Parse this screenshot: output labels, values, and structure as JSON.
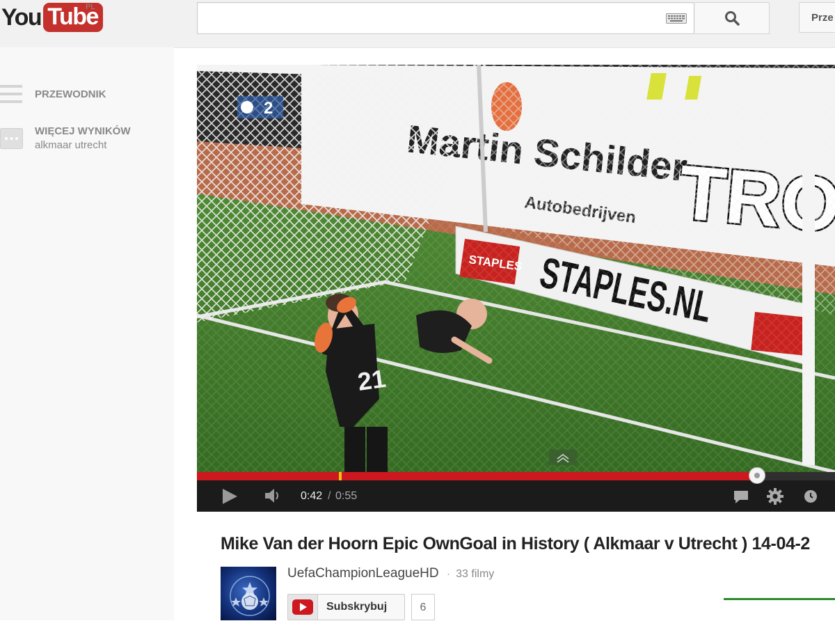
{
  "header": {
    "logo": {
      "you": "You",
      "tube": "Tube",
      "region": "PL"
    },
    "search": {
      "value": "",
      "placeholder": ""
    },
    "upload_label": "Prze"
  },
  "guide": {
    "items": [
      {
        "label": "PRZEWODNIK"
      },
      {
        "label": "WIĘCEJ WYNIKÓW",
        "sublabel": "alkmaar utrecht"
      }
    ]
  },
  "player": {
    "scene": {
      "banner1": "Martin Schilder",
      "banner1_sub": "Autobedrijven",
      "banner2": "TROT",
      "board_text": "STAPLES.NL",
      "board_logo": "STAPLES",
      "jersey_number": "21",
      "scoreboard": "2"
    },
    "progress": {
      "played_fraction": 0.878,
      "ad_marker_fraction": 0.223
    },
    "current_time": "0:42",
    "separator": "/",
    "duration": "0:55"
  },
  "video": {
    "title": "Mike Van der Hoorn Epic OwnGoal in History ( Alkmaar v Utrecht ) 14-04-2",
    "channel": {
      "name": "UefaChampionLeagueHD",
      "dot": "·",
      "video_count": "33 filmy"
    },
    "subscribe_label": "Subskrybuj",
    "subscriber_count": "6"
  },
  "colors": {
    "brand_red": "#cc181e",
    "logo_red": "#c4302b",
    "progress_marker": "#f4c20d",
    "like_green": "#2b8a2b"
  },
  "icons": [
    "search-icon",
    "keyboard-icon",
    "guide-menu-icon",
    "more-results-icon",
    "play-icon",
    "volume-icon",
    "captions-icon",
    "settings-icon",
    "watch-later-icon",
    "expand-icon",
    "youtube-play-icon"
  ]
}
